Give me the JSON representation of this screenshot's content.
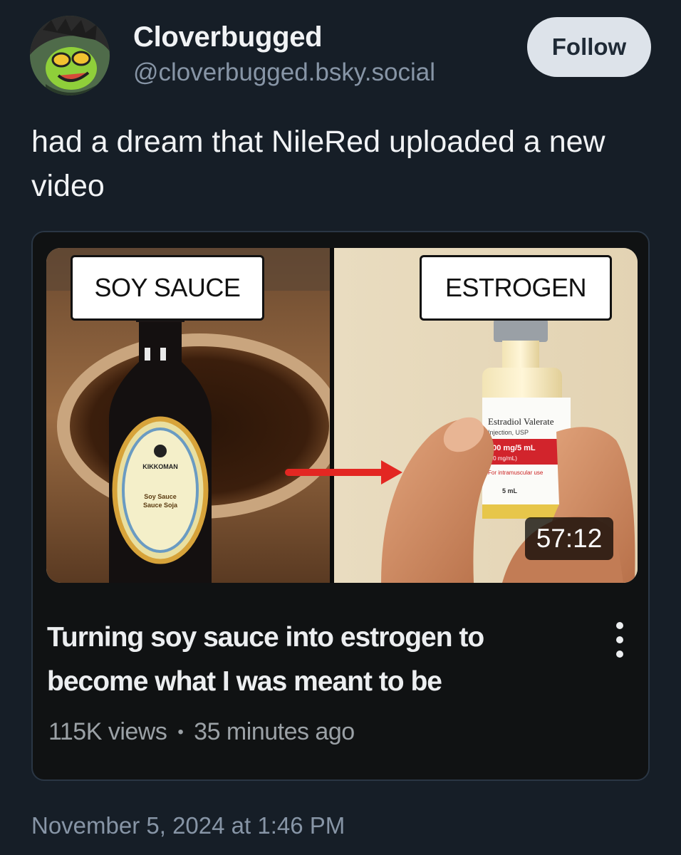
{
  "author": {
    "display_name": "Cloverbugged",
    "handle": "@cloverbugged.bsky.social",
    "follow_label": "Follow"
  },
  "post": {
    "text": "had a dream that NileRed uploaded a new video",
    "timestamp": "November 5, 2024 at 1:46 PM"
  },
  "embed": {
    "thumbnail": {
      "left_label": "SOY SAUCE",
      "right_label": "ESTROGEN",
      "duration": "57:12",
      "bottle_label_brand": "KIKKOMAN",
      "bottle_label_text1": "Soy Sauce",
      "bottle_label_text2": "Sauce Soja",
      "vial_label_name": "Estradiol Valerate",
      "vial_label_line1": "Injection, USP",
      "vial_label_dose": "100 mg/5 mL",
      "vial_label_line3": "(20 mg/mL)",
      "vial_label_line4": "For intramuscular use",
      "vial_label_volume": "5 mL"
    },
    "video_title": "Turning soy sauce into estrogen to become what I was meant to be",
    "views": "115K views",
    "separator": "•",
    "age": "35 minutes ago"
  },
  "colors": {
    "background": "#161e27",
    "follow_button_bg": "#dde3ea",
    "handle_gray": "#8795a6",
    "card_bg": "#101213",
    "arrow_red": "#e32722"
  },
  "icons": {
    "more": "vertical-ellipsis-icon",
    "arrow": "right-arrow-icon"
  }
}
